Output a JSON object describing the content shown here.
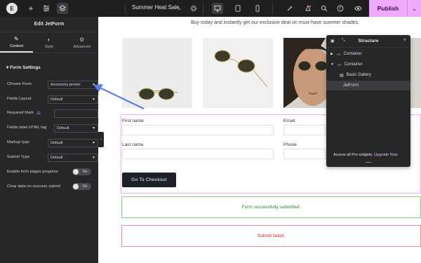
{
  "topbar": {
    "document_title": "Summer Heat Sale",
    "publish_label": "Publish"
  },
  "panel": {
    "title": "Edit JetForm",
    "tabs": [
      {
        "label": "Content",
        "icon": "pencil-icon"
      },
      {
        "label": "Style",
        "icon": "half-circle-icon"
      },
      {
        "label": "Advanced",
        "icon": "gear-icon"
      }
    ],
    "section": "Form Settings",
    "fields": {
      "choose_form": {
        "label": "Choose Form",
        "value": "Accessory promo"
      },
      "fields_layout": {
        "label": "Fields Layout",
        "value": "Default"
      },
      "required_mark": {
        "label": "Required Mark",
        "value": ""
      },
      "label_tag": {
        "label": "Fields label HTML tag",
        "value": "Default"
      },
      "markup_type": {
        "label": "Markup type",
        "value": "Default"
      },
      "submit_type": {
        "label": "Submit Type",
        "value": "Default"
      },
      "enable_progress": {
        "label": "Enable form pages progress",
        "value": "No"
      },
      "clear_data": {
        "label": "Clear data on success submit",
        "value": "No"
      }
    }
  },
  "canvas": {
    "tagline": "Buy today and instantly get our exclusive deal on must-have summer shades.",
    "form": {
      "first_name": "First name",
      "email": "Email",
      "last_name": "Last name",
      "phone": "Phone",
      "submit_label": "Go To Checkout"
    },
    "success_message": "Form successfully submitted.",
    "error_message": "Submit failed."
  },
  "structure": {
    "title": "Structure",
    "items": [
      {
        "label": "Container",
        "level": 0
      },
      {
        "label": "Container",
        "level": 0
      },
      {
        "label": "Basic Gallery",
        "level": 1
      },
      {
        "label": "JetForm",
        "level": 1
      }
    ],
    "promo_text": "Access all Pro widgets.",
    "promo_link": "Upgrade Now"
  },
  "colors": {
    "accent": "#f0abfc",
    "panel_bg": "#262729",
    "success": "#1f8a1f",
    "error": "#d0202f",
    "arrow": "#5b7fe8"
  }
}
